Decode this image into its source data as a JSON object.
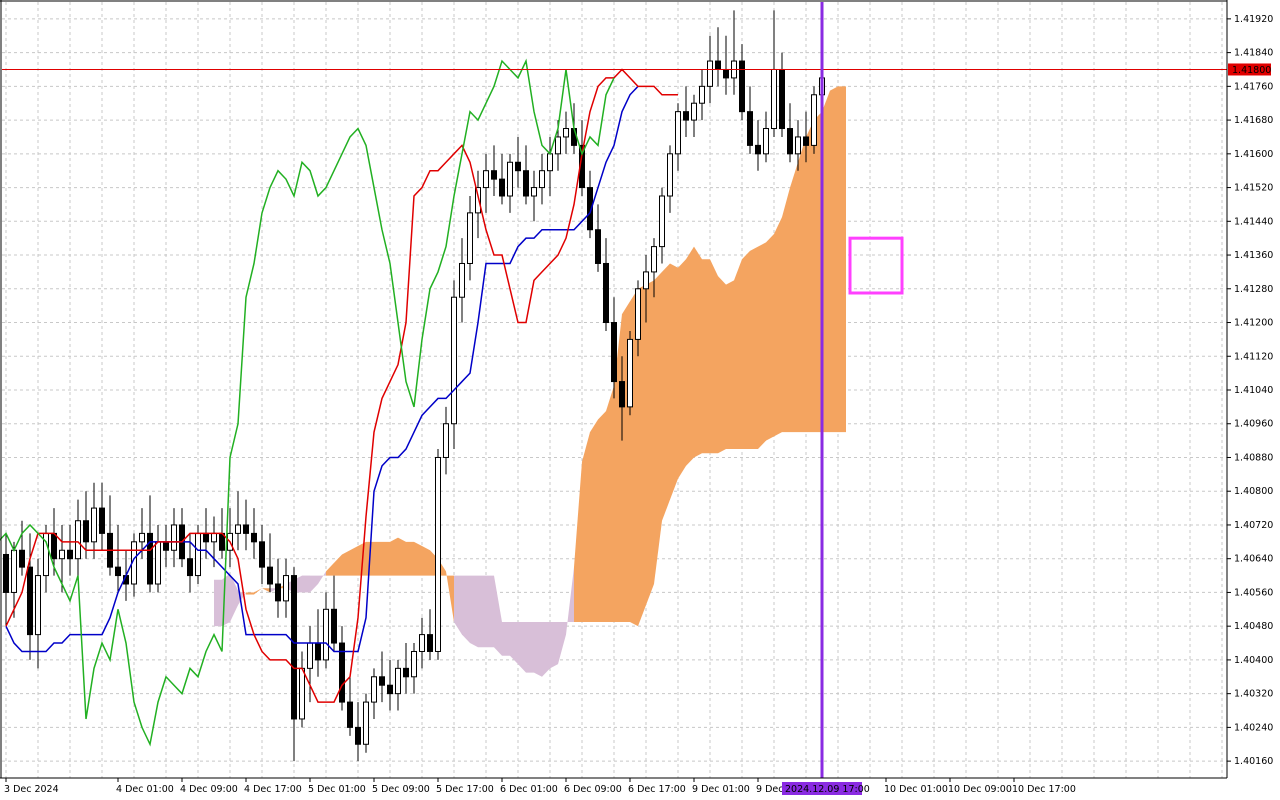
{
  "chart_data": {
    "type": "candlestick",
    "symbol_timeframe_hint": "",
    "ylim": [
      1.4012,
      1.4196
    ],
    "y_ticks": [
      "1.41920",
      "1.41840",
      "1.41760",
      "1.41680",
      "1.41600",
      "1.41520",
      "1.41440",
      "1.41360",
      "1.41280",
      "1.41200",
      "1.41120",
      "1.41040",
      "1.40960",
      "1.40880",
      "1.40800",
      "1.40720",
      "1.40640",
      "1.40560",
      "1.40480",
      "1.40400",
      "1.40320",
      "1.40240",
      "1.40160"
    ],
    "x_ticks": [
      {
        "label": "3 Dec 2024",
        "i": 0
      },
      {
        "label": "4 Dec 01:00",
        "i": 14
      },
      {
        "label": "4 Dec 09:00",
        "i": 22
      },
      {
        "label": "4 Dec 17:00",
        "i": 30
      },
      {
        "label": "5 Dec 01:00",
        "i": 38
      },
      {
        "label": "5 Dec 09:00",
        "i": 46
      },
      {
        "label": "5 Dec 17:00",
        "i": 54
      },
      {
        "label": "6 Dec 01:00",
        "i": 62
      },
      {
        "label": "6 Dec 09:00",
        "i": 70
      },
      {
        "label": "6 Dec 17:00",
        "i": 78
      },
      {
        "label": "9 Dec 01:00",
        "i": 86
      },
      {
        "label": "9 Dec 09:00",
        "i": 94
      },
      {
        "label": "10 Dec 01:00",
        "i": 110
      },
      {
        "label": "10 Dec 09:00",
        "i": 118
      },
      {
        "label": "10 Dec 17:00",
        "i": 126
      }
    ],
    "current_price": "1.41800",
    "current_price_value": 1.418,
    "marker": {
      "label": "2024.12.09 17:00",
      "i": 102
    },
    "highlight_box": {
      "i_start": 106,
      "i_end": 112,
      "y_low": 1.4127,
      "y_high": 1.414
    },
    "colors": {
      "tenkan": "#e00000",
      "kijun": "#0000c8",
      "chikou": "#22b022",
      "cloud_bull": "#f4a460",
      "cloud_bear": "#d8bfd8",
      "price_line": "#e00000",
      "marker_line": "#8a2be2",
      "highlight": "#ff40ff",
      "bull_candle": "#ffffff",
      "bear_candle": "#000000"
    },
    "candles": [
      [
        1.4065,
        1.407,
        1.4048,
        1.4056
      ],
      [
        1.4056,
        1.4068,
        1.405,
        1.4066
      ],
      [
        1.4066,
        1.4073,
        1.406,
        1.4062
      ],
      [
        1.4062,
        1.407,
        1.404,
        1.4046
      ],
      [
        1.4046,
        1.4064,
        1.4038,
        1.406
      ],
      [
        1.406,
        1.4072,
        1.4056,
        1.407
      ],
      [
        1.407,
        1.4076,
        1.406,
        1.4064
      ],
      [
        1.4064,
        1.4072,
        1.4056,
        1.4066
      ],
      [
        1.4066,
        1.4072,
        1.406,
        1.4064
      ],
      [
        1.4064,
        1.4078,
        1.406,
        1.4073
      ],
      [
        1.4073,
        1.408,
        1.4064,
        1.4068
      ],
      [
        1.4068,
        1.4082,
        1.4064,
        1.4076
      ],
      [
        1.4076,
        1.4082,
        1.4066,
        1.407
      ],
      [
        1.407,
        1.4079,
        1.406,
        1.4062
      ],
      [
        1.4062,
        1.4072,
        1.4056,
        1.406
      ],
      [
        1.406,
        1.4066,
        1.4054,
        1.4058
      ],
      [
        1.4058,
        1.407,
        1.4055,
        1.4068
      ],
      [
        1.4068,
        1.4076,
        1.4064,
        1.407
      ],
      [
        1.407,
        1.4079,
        1.4056,
        1.4058
      ],
      [
        1.4058,
        1.4072,
        1.4056,
        1.4068
      ],
      [
        1.4068,
        1.4072,
        1.4062,
        1.4066
      ],
      [
        1.4066,
        1.4076,
        1.4062,
        1.4072
      ],
      [
        1.4072,
        1.4076,
        1.4062,
        1.4064
      ],
      [
        1.4064,
        1.407,
        1.4056,
        1.406
      ],
      [
        1.406,
        1.4072,
        1.4058,
        1.407
      ],
      [
        1.407,
        1.4076,
        1.4064,
        1.4068
      ],
      [
        1.4068,
        1.4074,
        1.4062,
        1.407
      ],
      [
        1.407,
        1.4076,
        1.4064,
        1.4066
      ],
      [
        1.4066,
        1.4076,
        1.4062,
        1.407
      ],
      [
        1.407,
        1.408,
        1.4066,
        1.4072
      ],
      [
        1.4072,
        1.4078,
        1.4066,
        1.407
      ],
      [
        1.407,
        1.4076,
        1.4064,
        1.4068
      ],
      [
        1.4068,
        1.4072,
        1.4058,
        1.4062
      ],
      [
        1.4062,
        1.407,
        1.4056,
        1.4058
      ],
      [
        1.4058,
        1.4064,
        1.405,
        1.4054
      ],
      [
        1.4054,
        1.4064,
        1.405,
        1.406
      ],
      [
        1.406,
        1.4062,
        1.4016,
        1.4026
      ],
      [
        1.4026,
        1.4042,
        1.4024,
        1.4038
      ],
      [
        1.4038,
        1.4048,
        1.403,
        1.4044
      ],
      [
        1.4044,
        1.4052,
        1.4036,
        1.404
      ],
      [
        1.404,
        1.4056,
        1.4038,
        1.4052
      ],
      [
        1.4052,
        1.406,
        1.4042,
        1.4044
      ],
      [
        1.4044,
        1.4048,
        1.4028,
        1.403
      ],
      [
        1.403,
        1.4036,
        1.4022,
        1.4024
      ],
      [
        1.4024,
        1.403,
        1.4016,
        1.402
      ],
      [
        1.402,
        1.4032,
        1.4018,
        1.403
      ],
      [
        1.403,
        1.4038,
        1.4026,
        1.4036
      ],
      [
        1.4036,
        1.4042,
        1.403,
        1.4034
      ],
      [
        1.4034,
        1.404,
        1.4028,
        1.4032
      ],
      [
        1.4032,
        1.404,
        1.4028,
        1.4038
      ],
      [
        1.4038,
        1.4044,
        1.4032,
        1.4036
      ],
      [
        1.4036,
        1.4044,
        1.4032,
        1.4042
      ],
      [
        1.4042,
        1.405,
        1.4038,
        1.4046
      ],
      [
        1.4046,
        1.4052,
        1.404,
        1.4042
      ],
      [
        1.4042,
        1.409,
        1.404,
        1.4088
      ],
      [
        1.4088,
        1.41,
        1.4084,
        1.4096
      ],
      [
        1.4096,
        1.413,
        1.409,
        1.4126
      ],
      [
        1.4126,
        1.414,
        1.412,
        1.4134
      ],
      [
        1.4134,
        1.415,
        1.413,
        1.4146
      ],
      [
        1.4146,
        1.4156,
        1.414,
        1.4152
      ],
      [
        1.4152,
        1.416,
        1.4146,
        1.4156
      ],
      [
        1.4156,
        1.4162,
        1.415,
        1.4154
      ],
      [
        1.4154,
        1.416,
        1.4148,
        1.415
      ],
      [
        1.415,
        1.416,
        1.4146,
        1.4158
      ],
      [
        1.4158,
        1.4164,
        1.4152,
        1.4156
      ],
      [
        1.4156,
        1.4162,
        1.4148,
        1.415
      ],
      [
        1.415,
        1.4156,
        1.4144,
        1.4152
      ],
      [
        1.4152,
        1.416,
        1.4148,
        1.4156
      ],
      [
        1.4156,
        1.4164,
        1.415,
        1.416
      ],
      [
        1.416,
        1.4168,
        1.4156,
        1.4164
      ],
      [
        1.4164,
        1.417,
        1.416,
        1.4166
      ],
      [
        1.4166,
        1.4172,
        1.416,
        1.4162
      ],
      [
        1.4162,
        1.4168,
        1.415,
        1.4152
      ],
      [
        1.4152,
        1.4156,
        1.414,
        1.4142
      ],
      [
        1.4142,
        1.4148,
        1.4132,
        1.4134
      ],
      [
        1.4134,
        1.414,
        1.4118,
        1.412
      ],
      [
        1.412,
        1.4126,
        1.4102,
        1.4106
      ],
      [
        1.4106,
        1.4112,
        1.4092,
        1.41
      ],
      [
        1.41,
        1.4118,
        1.4098,
        1.4116
      ],
      [
        1.4116,
        1.413,
        1.4112,
        1.4128
      ],
      [
        1.4128,
        1.4136,
        1.412,
        1.4132
      ],
      [
        1.4132,
        1.414,
        1.4126,
        1.4138
      ],
      [
        1.4138,
        1.4152,
        1.4134,
        1.415
      ],
      [
        1.415,
        1.4162,
        1.4146,
        1.416
      ],
      [
        1.416,
        1.4172,
        1.4156,
        1.417
      ],
      [
        1.417,
        1.4176,
        1.4164,
        1.4168
      ],
      [
        1.4168,
        1.4174,
        1.4164,
        1.4172
      ],
      [
        1.4172,
        1.418,
        1.4168,
        1.4176
      ],
      [
        1.4176,
        1.4188,
        1.4172,
        1.4182
      ],
      [
        1.4182,
        1.419,
        1.4176,
        1.418
      ],
      [
        1.418,
        1.4188,
        1.4174,
        1.4178
      ],
      [
        1.4178,
        1.4194,
        1.4174,
        1.4182
      ],
      [
        1.4182,
        1.4186,
        1.4168,
        1.417
      ],
      [
        1.417,
        1.4176,
        1.416,
        1.4162
      ],
      [
        1.4162,
        1.4168,
        1.4156,
        1.416
      ],
      [
        1.416,
        1.417,
        1.4158,
        1.4166
      ],
      [
        1.4166,
        1.4194,
        1.4164,
        1.418
      ],
      [
        1.418,
        1.4184,
        1.4164,
        1.4166
      ],
      [
        1.4166,
        1.4172,
        1.4158,
        1.416
      ],
      [
        1.416,
        1.4168,
        1.4156,
        1.4164
      ],
      [
        1.4164,
        1.417,
        1.4158,
        1.4162
      ],
      [
        1.4162,
        1.4176,
        1.416,
        1.4174
      ],
      [
        1.4174,
        1.418,
        1.417,
        1.4178
      ]
    ],
    "tenkan": [
      1.4048,
      1.4052,
      1.4056,
      1.4064,
      1.407,
      1.407,
      1.407,
      1.4068,
      1.4068,
      1.4068,
      1.4066,
      1.4066,
      1.4066,
      1.4066,
      1.4066,
      1.4066,
      1.4066,
      1.4066,
      1.4066,
      1.4068,
      1.4068,
      1.4068,
      1.4068,
      1.407,
      1.407,
      1.407,
      1.407,
      1.407,
      1.4068,
      1.4064,
      1.4052,
      1.4046,
      1.4042,
      1.404,
      1.404,
      1.404,
      1.4038,
      1.4038,
      1.4034,
      1.403,
      1.403,
      1.403,
      1.4034,
      1.4036,
      1.405,
      1.4074,
      1.4094,
      1.4102,
      1.4106,
      1.411,
      1.412,
      1.415,
      1.4152,
      1.4156,
      1.4156,
      1.4158,
      1.416,
      1.4162,
      1.4158,
      1.415,
      1.4142,
      1.4136,
      1.4136,
      1.4128,
      1.412,
      1.412,
      1.413,
      1.4132,
      1.4134,
      1.4136,
      1.414,
      1.4148,
      1.416,
      1.417,
      1.4176,
      1.4178,
      1.4178,
      1.418,
      1.4178,
      1.4176,
      1.4176,
      1.4176,
      1.4174,
      1.4174,
      1.4174
    ],
    "kijun": [
      1.4048,
      1.4044,
      1.4042,
      1.4042,
      1.4042,
      1.4042,
      1.4044,
      1.4044,
      1.4046,
      1.4046,
      1.4046,
      1.4046,
      1.4046,
      1.405,
      1.4056,
      1.406,
      1.4064,
      1.4066,
      1.4068,
      1.4068,
      1.4068,
      1.4068,
      1.4068,
      1.4068,
      1.4066,
      1.4066,
      1.4064,
      1.4062,
      1.406,
      1.4058,
      1.4046,
      1.4046,
      1.4046,
      1.4046,
      1.4046,
      1.4046,
      1.4044,
      1.4044,
      1.4044,
      1.4044,
      1.4044,
      1.4042,
      1.4042,
      1.4042,
      1.4042,
      1.405,
      1.408,
      1.4086,
      1.4088,
      1.4088,
      1.409,
      1.4094,
      1.4098,
      1.41,
      1.4102,
      1.4102,
      1.4104,
      1.4106,
      1.4108,
      1.412,
      1.4134,
      1.4134,
      1.4134,
      1.4134,
      1.4138,
      1.414,
      1.414,
      1.4142,
      1.4142,
      1.4142,
      1.4142,
      1.4142,
      1.4144,
      1.4146,
      1.4152,
      1.4158,
      1.4162,
      1.417,
      1.4174,
      1.4176
    ]
  }
}
